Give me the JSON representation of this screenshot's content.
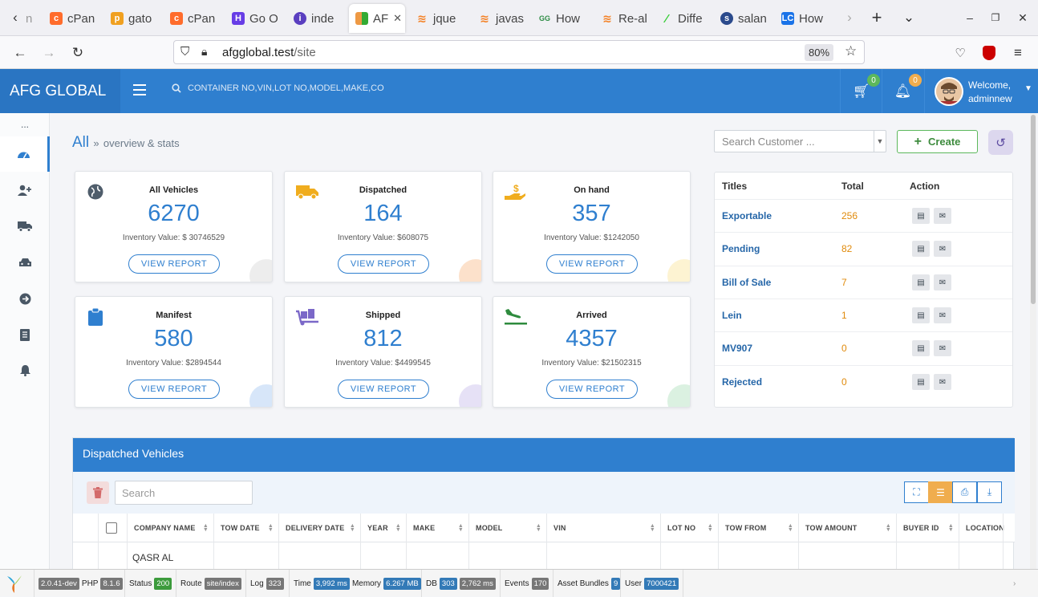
{
  "browser": {
    "tabs": [
      "n",
      "cPan",
      "gato",
      "cPan",
      "Go O",
      "inde",
      "AF",
      "jque",
      "javas",
      "How",
      "Re-al",
      "Diffe",
      "salan",
      "How"
    ],
    "url_host": "afgglobal.test",
    "url_path": "/site",
    "zoom": "80%"
  },
  "header": {
    "brand": "AFG GLOBAL",
    "search_placeholder": "CONTAINER NO,VIN,LOT NO,MODEL,MAKE,CO",
    "cart_count": "0",
    "notif_count": "0",
    "welcome": "Welcome,",
    "username": "adminnew"
  },
  "sidebar": {
    "dots": "..."
  },
  "breadcrumb": {
    "title": "All",
    "sep": "»",
    "sub": "overview & stats"
  },
  "toolbar": {
    "customer_placeholder": "Search Customer ...",
    "create_label": "Create"
  },
  "cards": [
    {
      "title": "All Vehicles",
      "count": "6270",
      "value": "Inventory Value: $ 30746529",
      "btn": "VIEW REPORT",
      "icon": "globe-icon"
    },
    {
      "title": "Dispatched",
      "count": "164",
      "value": "Inventory Value: $608075",
      "btn": "VIEW REPORT",
      "icon": "truck-icon"
    },
    {
      "title": "On hand",
      "count": "357",
      "value": "Inventory Value: $1242050",
      "btn": "VIEW REPORT",
      "icon": "money-hand-icon"
    },
    {
      "title": "Manifest",
      "count": "580",
      "value": "Inventory Value: $2894544",
      "btn": "VIEW REPORT",
      "icon": "clipboard-icon"
    },
    {
      "title": "Shipped",
      "count": "812",
      "value": "Inventory Value: $4499545",
      "btn": "VIEW REPORT",
      "icon": "dolly-icon"
    },
    {
      "title": "Arrived",
      "count": "4357",
      "value": "Inventory Value: $21502315",
      "btn": "VIEW REPORT",
      "icon": "plane-arrival-icon"
    }
  ],
  "titles_table": {
    "headers": [
      "Titles",
      "Total",
      "Action"
    ],
    "rows": [
      {
        "name": "Exportable",
        "total": "256"
      },
      {
        "name": "Pending",
        "total": "82"
      },
      {
        "name": "Bill of Sale",
        "total": "7"
      },
      {
        "name": "Lein",
        "total": "1"
      },
      {
        "name": "MV907",
        "total": "0"
      },
      {
        "name": "Rejected",
        "total": "0"
      }
    ]
  },
  "dispatched": {
    "title": "Dispatched Vehicles",
    "search_placeholder": "Search",
    "columns": [
      "COMPANY NAME",
      "TOW DATE",
      "DELIVERY DATE",
      "YEAR",
      "MAKE",
      "MODEL",
      "VIN",
      "LOT NO",
      "TOW FROM",
      "TOW AMOUNT",
      "BUYER ID",
      "LOCATION"
    ],
    "first_row_company": "QASR AL"
  },
  "debug": {
    "version": "2.0.41-dev",
    "php_label": "PHP",
    "php": "8.1.6",
    "status_label": "Status",
    "status": "200",
    "route_label": "Route",
    "route": "site/index",
    "log_label": "Log",
    "log": "323",
    "time_label": "Time",
    "time": "3,992 ms",
    "memory_label": "Memory",
    "memory": "6.267 MB",
    "db_label": "DB",
    "db": "303",
    "db_time": "2,762 ms",
    "events_label": "Events",
    "events": "170",
    "assets_label": "Asset Bundles",
    "assets": "9",
    "user_label": "User",
    "user": "7000421"
  }
}
